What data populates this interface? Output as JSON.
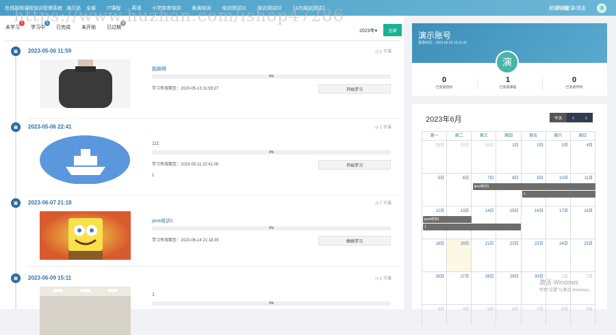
{
  "topbar": {
    "brand": "在线视频课程培训管理系统",
    "home": "演示站",
    "nav": [
      "全部",
      "IT课程",
      "英语",
      "小学体育培训",
      "表演培训",
      "培训测试01",
      "培训测试02",
      "1125培训测试2"
    ],
    "user": "超级主播",
    "logout": "退出登录/退出",
    "avatar": "演"
  },
  "watermark": "https://www.huzhan.com/ishop47286",
  "tabs": [
    {
      "label": "未学习",
      "badge": "1",
      "badge_color": "#e0453a"
    },
    {
      "label": "学习中",
      "badge": "1",
      "badge_color": "#3e86c9"
    },
    {
      "label": "已完成",
      "badge": "",
      "badge_color": ""
    },
    {
      "label": "未开始",
      "badge": "",
      "badge_color": ""
    },
    {
      "label": "已过期",
      "badge": "4",
      "badge_color": "#9a9a9a"
    }
  ],
  "year_select": "2023年▾",
  "filter_button": "全部",
  "entries": [
    {
      "time": "2023-05-06 11:59",
      "ago": "◷ 1 节课",
      "title": "胶脚得",
      "progress": "0%",
      "valid": "学习有效期至：2023-05-13 11:59:27",
      "button": "开始学习",
      "extra": "",
      "thumb": "sweater"
    },
    {
      "time": "2023-05-06 22:41",
      "ago": "◷ 1 节课",
      "title": "111",
      "progress": "0%",
      "valid": "学习有效期至：2023-05-11 22:41:05",
      "button": "开始学习",
      "extra": "1",
      "thumb": "ship"
    },
    {
      "time": "2023-06-07 21:18",
      "ago": "◷ 7 节课",
      "title": "java培训1",
      "progress": "0%",
      "valid": "学习有效期至：2023-06-14 21:18:35",
      "button": "继续学习",
      "extra": "",
      "thumb": "sponge"
    },
    {
      "time": "2023-06-09 15:11",
      "ago": "◷ 1 节课",
      "title": "1",
      "progress": "0%",
      "valid": "",
      "button": "",
      "extra": "",
      "thumb": "room"
    }
  ],
  "profile": {
    "name": "演示账号",
    "login": "登录时间：2023-06-20 16:11:42",
    "avatar": "演",
    "stats": [
      {
        "num": "0",
        "label": "已完成培训"
      },
      {
        "num": "1",
        "label": "已完成课程"
      },
      {
        "num": "0",
        "label": "已完成学时"
      }
    ]
  },
  "calendar": {
    "title": "2023年6月",
    "today_button": "今天",
    "prev": "‹",
    "next": "›",
    "weekdays": [
      "周一",
      "周二",
      "周三",
      "周四",
      "周五",
      "周六",
      "周日"
    ],
    "weeks": [
      [
        "29日",
        "30日",
        "31日",
        "1日",
        "2日",
        "3日",
        "4日"
      ],
      [
        "5日",
        "6日",
        "7日",
        "8日",
        "9日",
        "10日",
        "11日"
      ],
      [
        "12日",
        "13日",
        "14日",
        "15日",
        "16日",
        "17日",
        "18日"
      ],
      [
        "19日",
        "20日",
        "21日",
        "22日",
        "23日",
        "24日",
        "25日"
      ],
      [
        "26日",
        "27日",
        "28日",
        "29日",
        "30日",
        "1日",
        "2日"
      ],
      [
        "3日",
        "4日",
        "5日",
        "6日",
        "7日",
        "8日",
        "9日"
      ]
    ],
    "events": [
      {
        "week": 1,
        "start": 2,
        "end": 6,
        "label": "java培训1"
      },
      {
        "week": 1,
        "start": 4,
        "end": 6,
        "label": "1"
      },
      {
        "week": 2,
        "start": 0,
        "end": 1,
        "label": "java培训1"
      },
      {
        "week": 2,
        "start": 0,
        "end": 3,
        "label": "1"
      }
    ]
  },
  "windows_watermark": {
    "line1": "激活 Windows",
    "line2": "转到\"设置\"以激活 Windows。"
  }
}
